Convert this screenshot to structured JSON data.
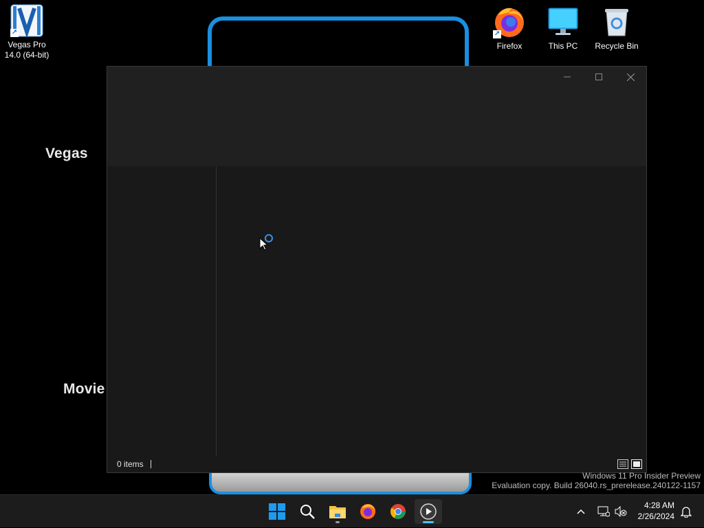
{
  "desktop": {
    "icons": [
      {
        "label_line1": "Vegas Pro",
        "label_line2": "14.0 (64-bit)"
      },
      {
        "label": "Firefox"
      },
      {
        "label": "This PC"
      },
      {
        "label": "Recycle Bin"
      }
    ],
    "wallpaper_text": {
      "vegas": "Vegas",
      "movie": "Movie"
    },
    "watermark": {
      "line1": "Windows 11 Pro Insider Preview",
      "line2": "Evaluation copy. Build 26040.rs_prerelease.240122-1157"
    }
  },
  "window": {
    "status": {
      "items_count": "0 items"
    },
    "controls": {
      "minimize": "minimize-icon",
      "maximize": "maximize-icon",
      "close": "close-icon"
    },
    "loading": true
  },
  "taskbar": {
    "apps": [
      "windows-start",
      "search",
      "file-explorer",
      "firefox",
      "chrome",
      "media-player"
    ],
    "active_app": "media-player",
    "clock": {
      "time": "4:28 AM",
      "date": "2/26/2024"
    }
  },
  "colors": {
    "accent": "#4cc2ff",
    "wallpaper_frame": "#1a8fe0",
    "window_bg": "#191919",
    "taskbar_bg": "#1c1c1c"
  }
}
